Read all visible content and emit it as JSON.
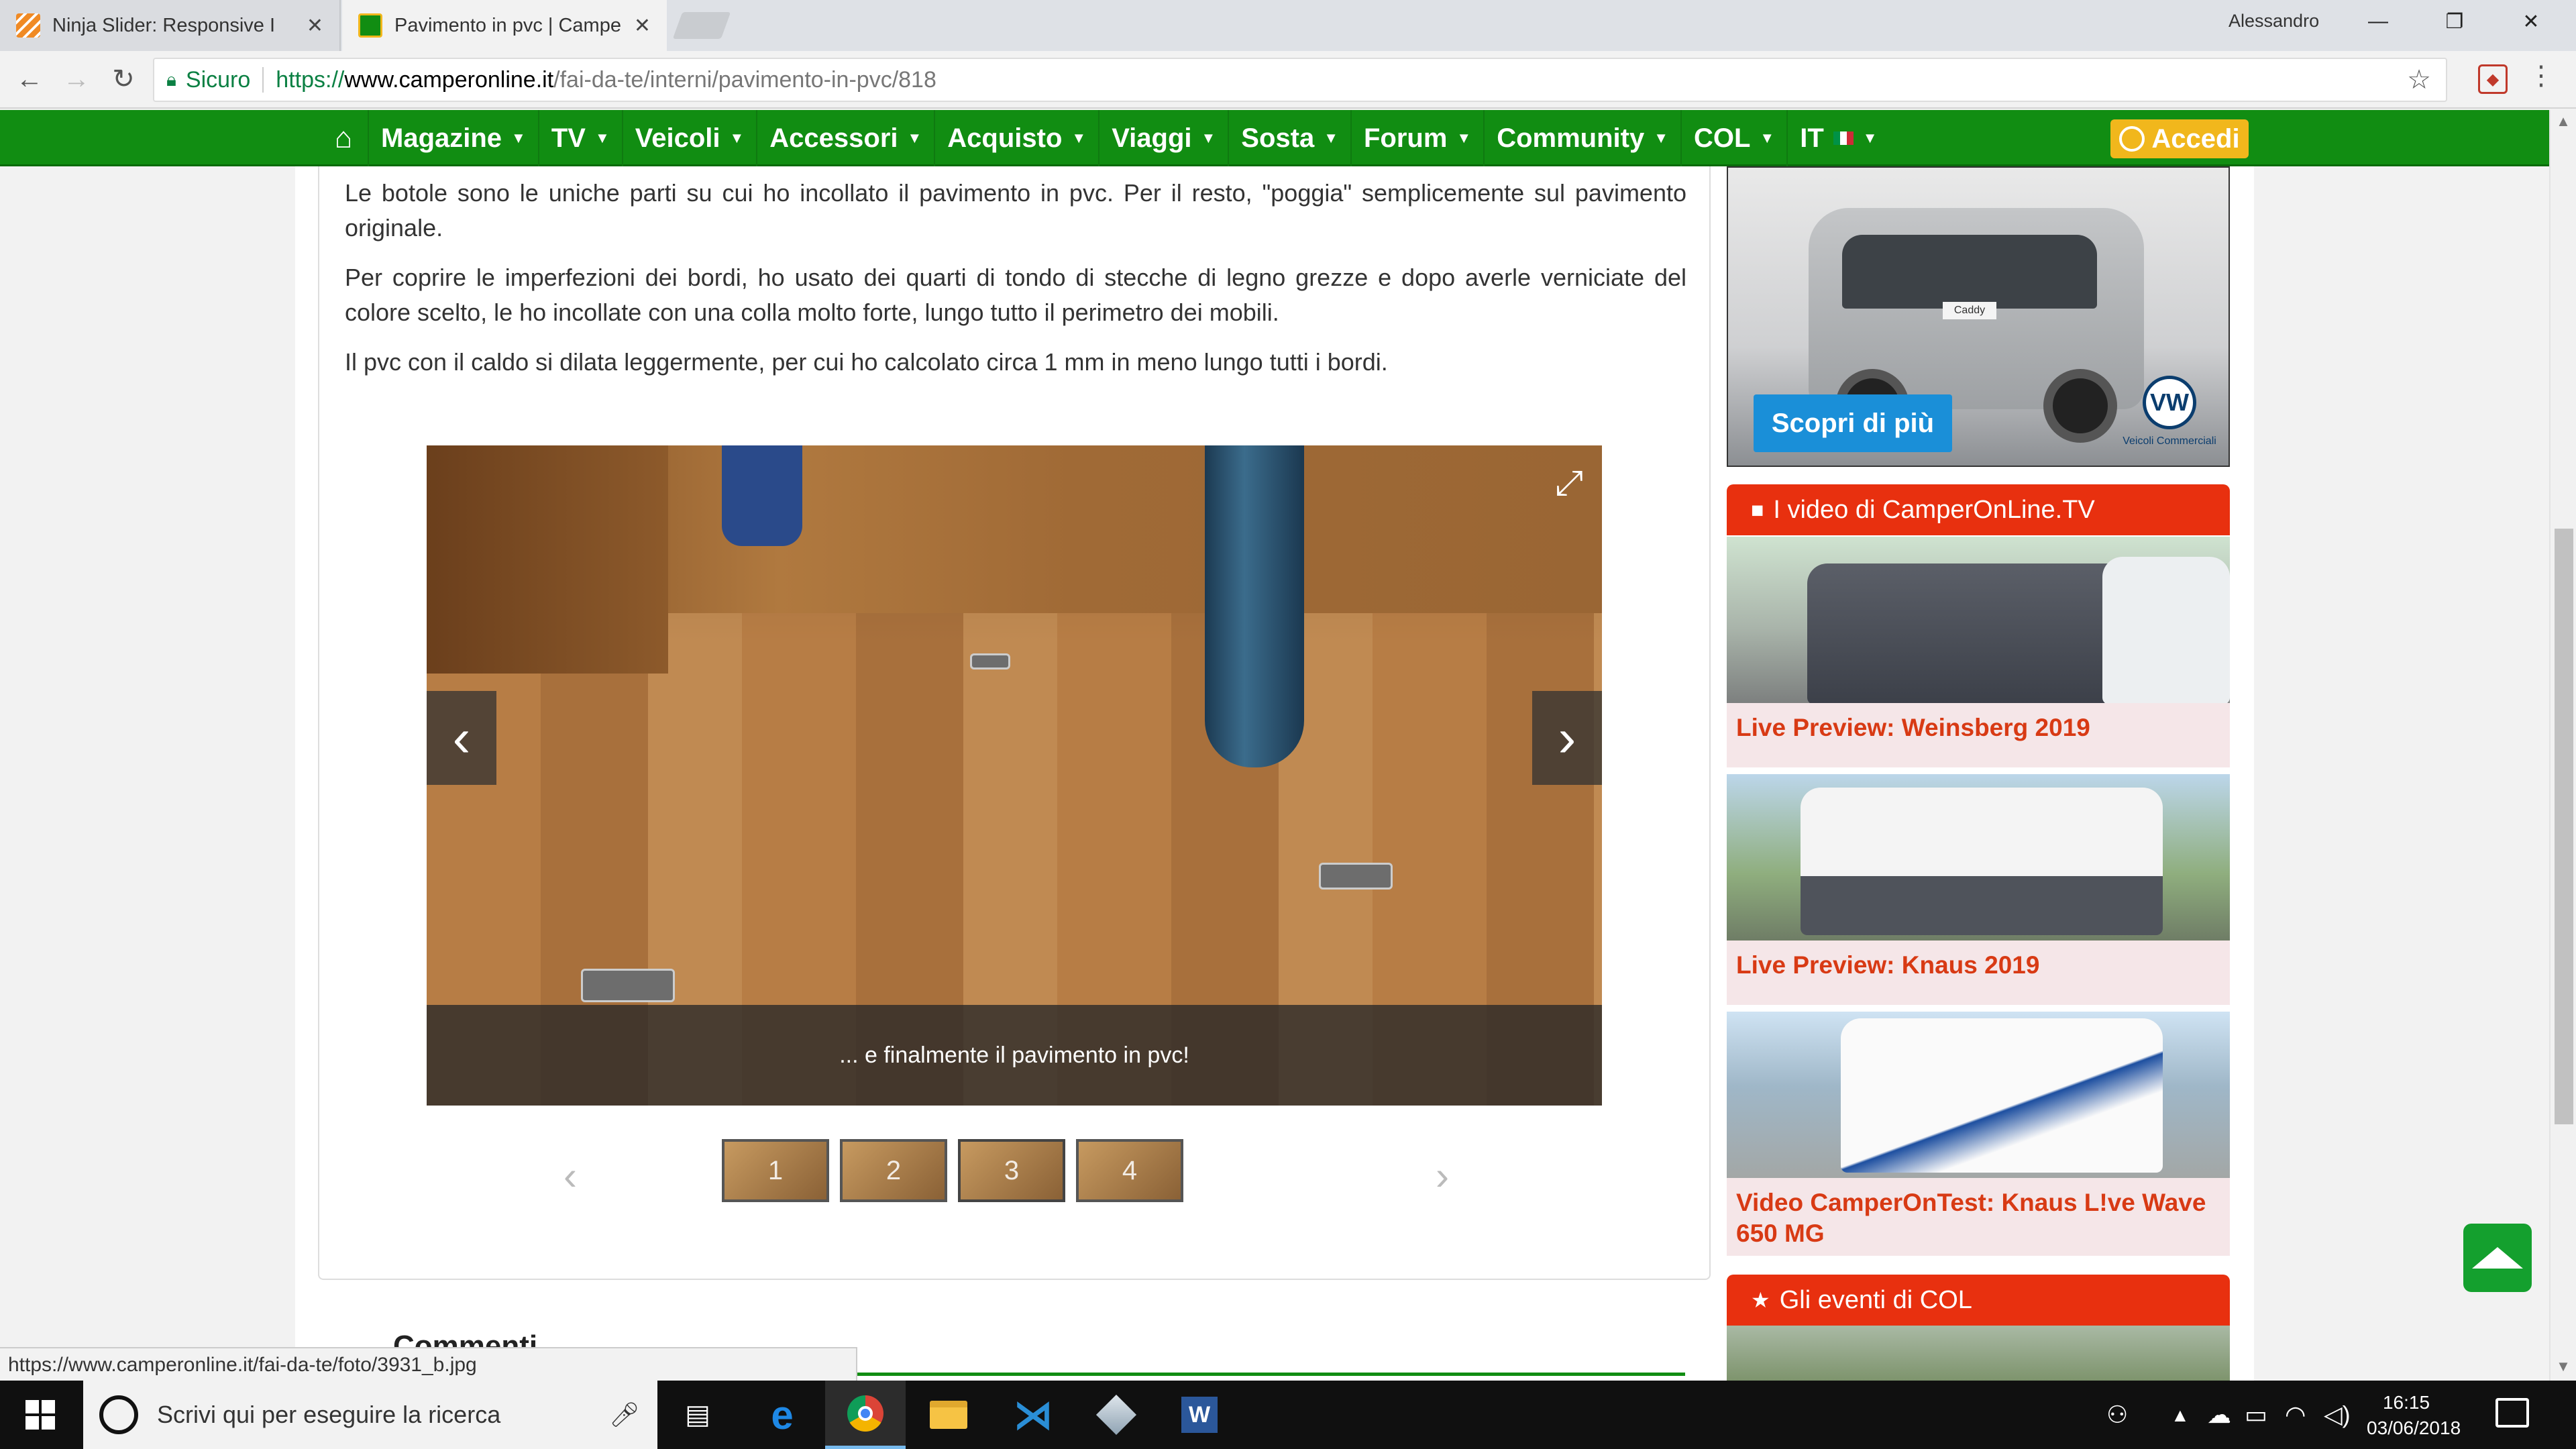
{
  "browser": {
    "tabs": [
      {
        "title": "Ninja Slider: Responsive I",
        "active": false
      },
      {
        "title": "Pavimento in pvc | Campe",
        "active": true
      }
    ],
    "profile_name": "Alessandro",
    "secure_label": "Sicuro",
    "url_protocol": "https://",
    "url_host": "www.camperonline.it",
    "url_path": "/fai-da-te/interni/pavimento-in-pvc/818",
    "status_url": "https://www.camperonline.it/fai-da-te/foto/3931_b.jpg"
  },
  "site_nav": {
    "items": [
      "Magazine",
      "TV",
      "Veicoli",
      "Accessori",
      "Acquisto",
      "Viaggi",
      "Sosta",
      "Forum",
      "Community",
      "COL",
      "IT"
    ],
    "login_label": "Accedi",
    "colors": {
      "nav_bg": "#118d12",
      "login_bg": "#f1b71c"
    }
  },
  "article": {
    "paragraphs": [
      "Le botole sono le uniche parti su cui ho incollato il pavimento in pvc. Per il resto, \"poggia\" semplicemente sul pavimento originale.",
      "Per coprire le imperfezioni dei bordi, ho usato dei quarti di tondo di stecche di legno grezze e dopo averle verniciate del colore scelto, le ho incollate con una colla molto forte, lungo tutto il perimetro dei mobili.",
      "Il pvc con il caldo si dilata leggermente, per cui ho calcolato circa 1 mm in meno lungo tutti i bordi."
    ],
    "slider": {
      "caption": "... e finalmente il pavimento in pvc!",
      "thumbnails": [
        "1",
        "2",
        "3",
        "4"
      ],
      "active_thumbnail": 3
    },
    "comments_heading": "Commenti"
  },
  "sidebar": {
    "ad": {
      "cta": "Scopri di più",
      "brand_text": "Veicoli Commerciali",
      "plate": "Caddy"
    },
    "video_section_title": "I video di CamperOnLine.TV",
    "videos": [
      {
        "title": "Live Preview: Weinsberg 2019"
      },
      {
        "title": "Live Preview: Knaus 2019"
      },
      {
        "title": "Video CamperOnTest: Knaus L!ve Wave 650 MG"
      }
    ],
    "events_section_title": "Gli eventi di COL"
  },
  "taskbar": {
    "search_placeholder": "Scrivi qui per eseguire la ricerca",
    "time": "16:15",
    "date": "03/06/2018"
  }
}
